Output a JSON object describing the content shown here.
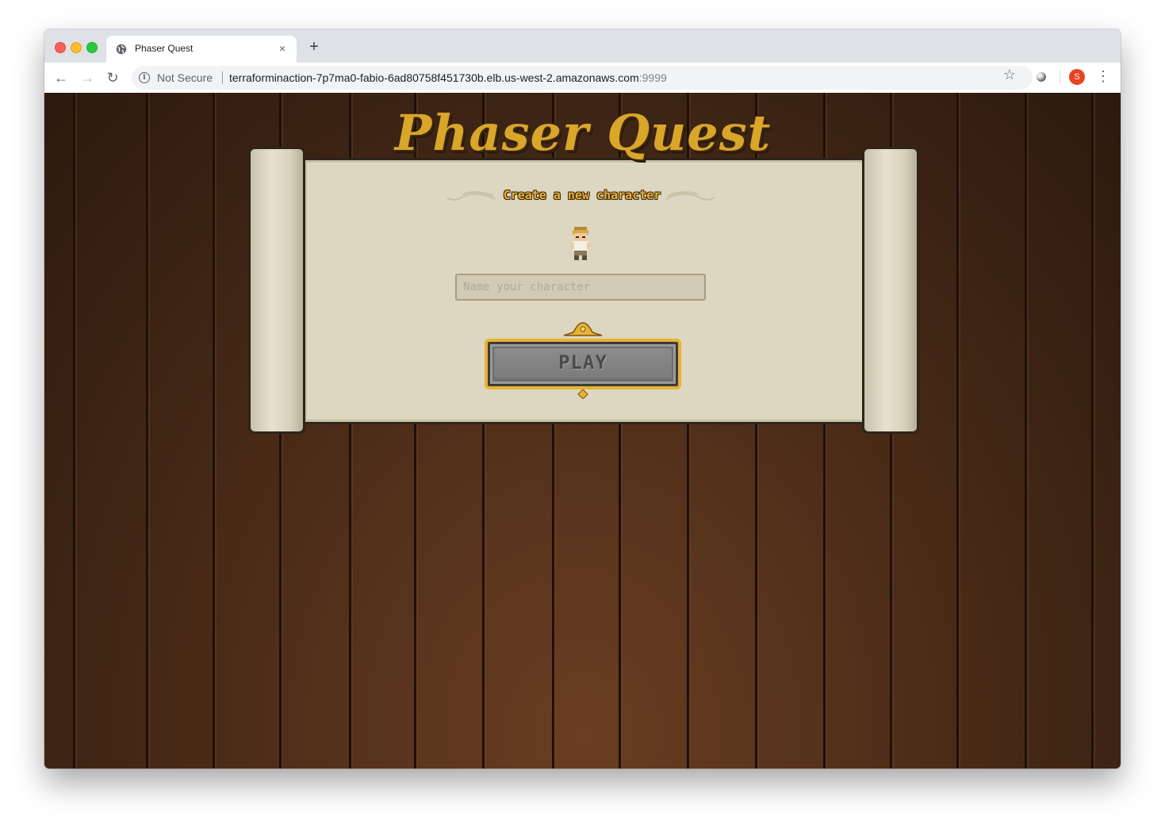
{
  "browser": {
    "tab": {
      "title": "Phaser Quest",
      "close_glyph": "×",
      "favicon": "globe-icon"
    },
    "new_tab_glyph": "+",
    "toolbar": {
      "back_glyph": "←",
      "forward_glyph": "→",
      "reload_glyph": "↻",
      "security_label": "Not Secure",
      "info_glyph": "i",
      "url_host": "terraforminaction-7p7ma0-fabio-6ad80758f451730b.elb.us-west-2.amazonaws.com",
      "url_port": ":9999",
      "bookmark_glyph": "☆",
      "profile_initial": "S",
      "menu_glyph": "⋮"
    }
  },
  "game": {
    "title": "Phaser Quest",
    "subtitle": "Create a new character",
    "name_input": {
      "value": "",
      "placeholder": "Name your character"
    },
    "play_label": "PLAY"
  },
  "colors": {
    "gold": "#e8b232",
    "parchment": "#ddd6c1",
    "wood_dark": "#2b1a0e",
    "wood_light": "#6a3e22",
    "profile_red": "#e8431f"
  }
}
